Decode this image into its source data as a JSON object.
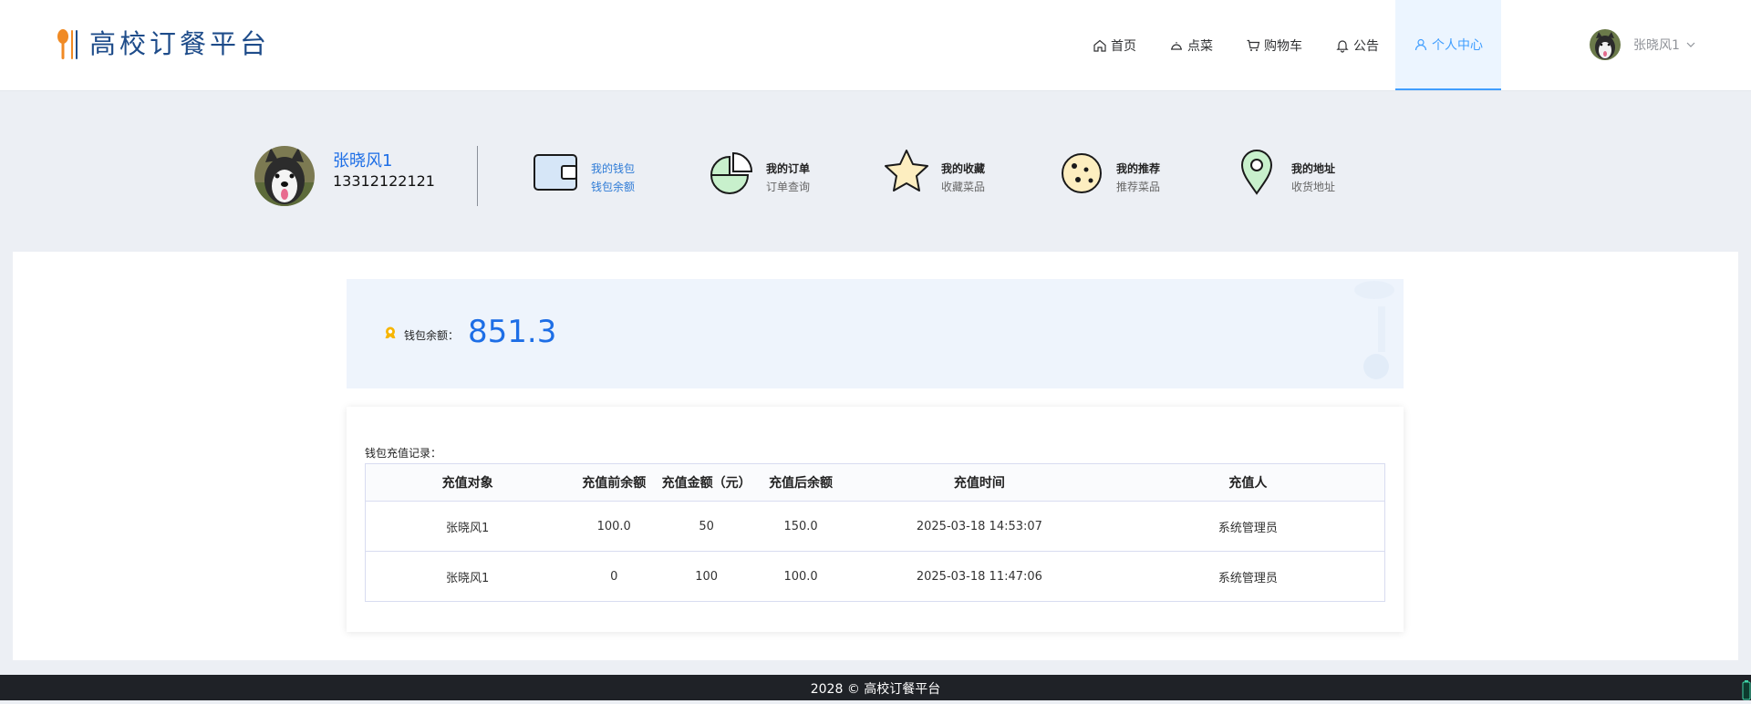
{
  "brand": {
    "name": "高校订餐平台"
  },
  "nav": {
    "items": [
      {
        "label": "首页",
        "icon": "home-icon"
      },
      {
        "label": "点菜",
        "icon": "dish-cover-icon"
      },
      {
        "label": "购物车",
        "icon": "cart-icon"
      },
      {
        "label": "公告",
        "icon": "bell-icon"
      },
      {
        "label": "个人中心",
        "icon": "user-icon",
        "active": true
      }
    ],
    "user": {
      "name": "张晓风1"
    }
  },
  "profile": {
    "name": "张晓风1",
    "phone": "13312122121",
    "menu": [
      {
        "title": "我的钱包",
        "subtitle": "钱包余额",
        "icon": "wallet-icon",
        "active": true
      },
      {
        "title": "我的订单",
        "subtitle": "订单查询",
        "icon": "pie-chart-icon"
      },
      {
        "title": "我的收藏",
        "subtitle": "收藏菜品",
        "icon": "star-icon"
      },
      {
        "title": "我的推荐",
        "subtitle": "推荐菜品",
        "icon": "cookie-icon"
      },
      {
        "title": "我的地址",
        "subtitle": "收货地址",
        "icon": "location-pin-icon"
      }
    ]
  },
  "wallet": {
    "label": "钱包余额：",
    "balance": "851.3"
  },
  "records": {
    "title": "钱包充值记录：",
    "columns": [
      "充值对象",
      "充值前余额",
      "充值金额（元）",
      "充值后余额",
      "充值时间",
      "充值人"
    ],
    "rows": [
      [
        "张晓风1",
        "100.0",
        "50",
        "150.0",
        "2025-03-18 14:53:07",
        "系统管理员"
      ],
      [
        "张晓风1",
        "0",
        "100",
        "100.0",
        "2025-03-18 11:47:06",
        "系统管理员"
      ]
    ]
  },
  "footer": {
    "text": "2028 © 高校订餐平台"
  },
  "colors": {
    "accent": "#409eff",
    "brand_text": "#1e4c8a",
    "balance": "#1d6ee6",
    "footer_bg": "#1f2227"
  }
}
